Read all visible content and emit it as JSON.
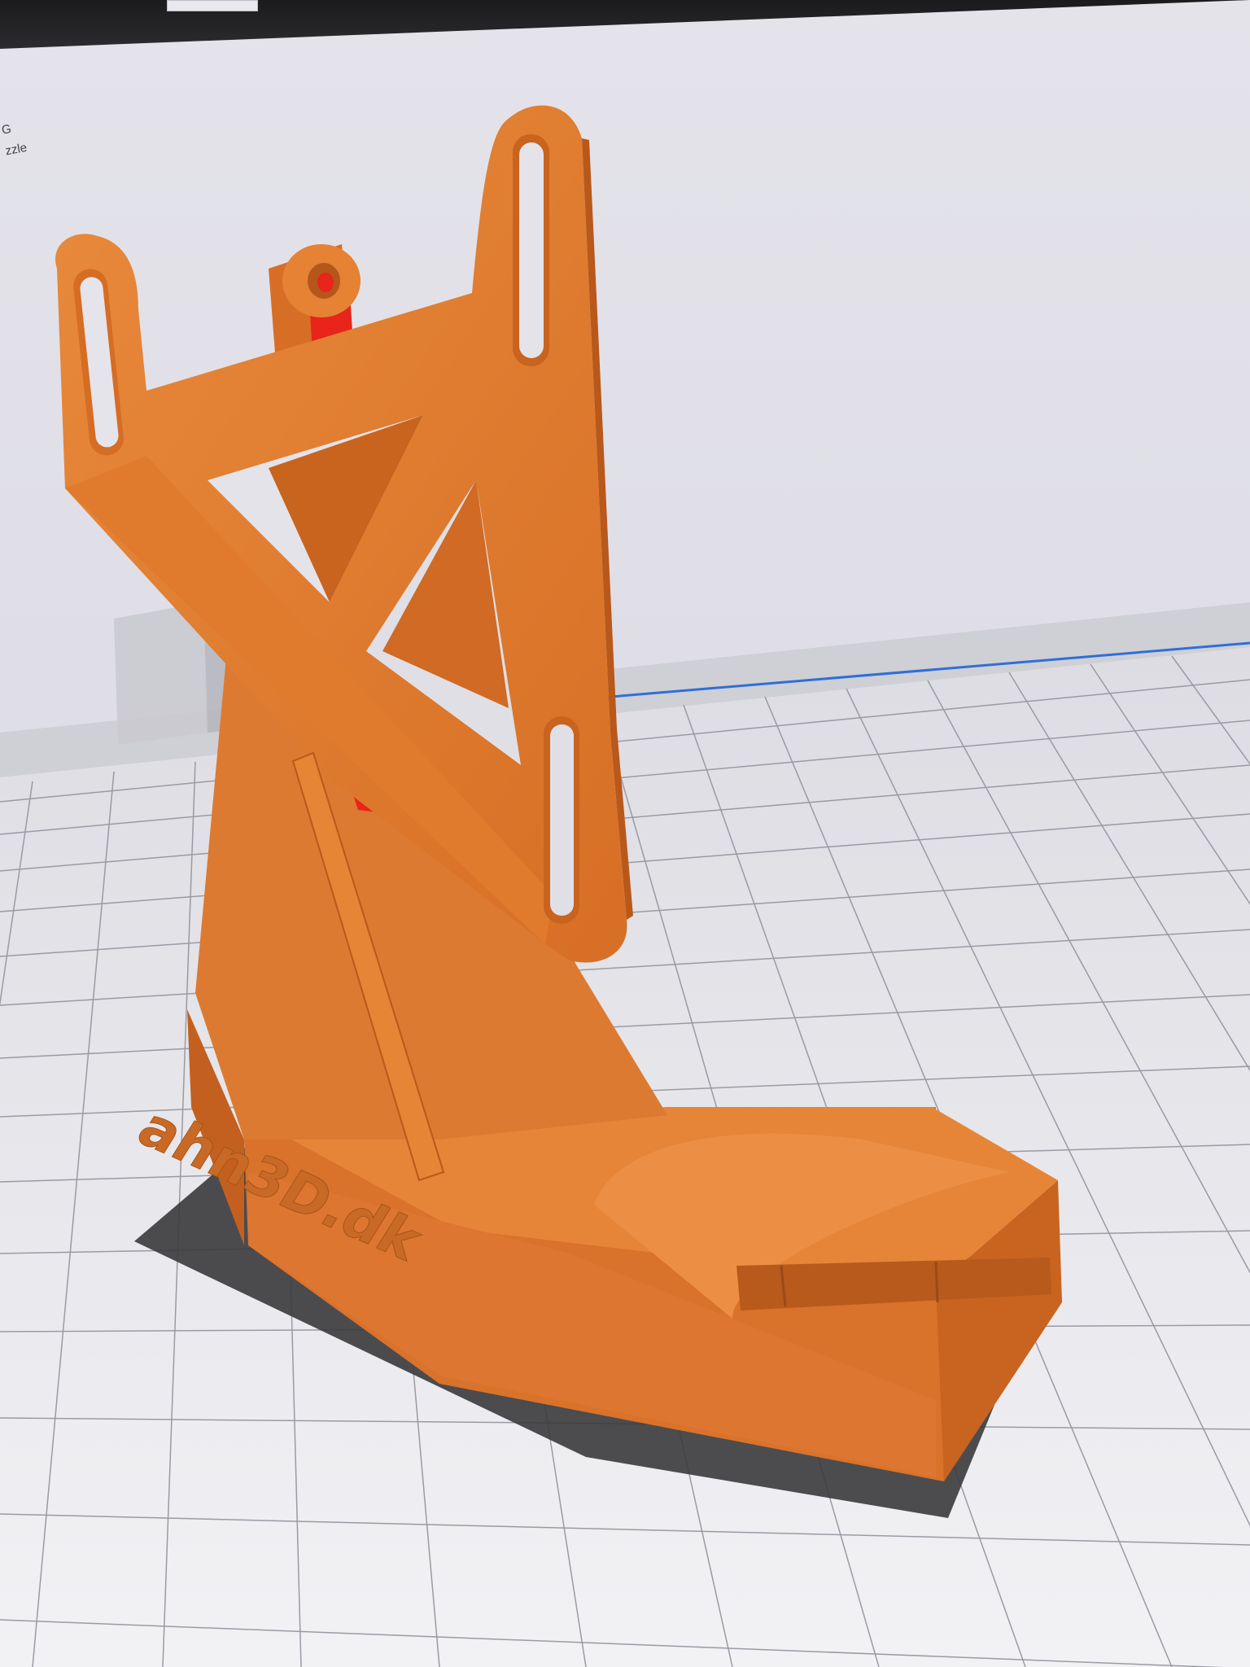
{
  "app": {
    "header_lines": [
      "G",
      "zzle"
    ]
  },
  "viewport": {
    "model_embossed_text": "ahn3D.dk",
    "colors": {
      "model": "#e07b2e",
      "model_shadow": "#b8571a",
      "overhang": "#e8241b",
      "build_plate": "#e9e9ee",
      "grid_line": "#9a9aa4",
      "background": "#e2e1e8",
      "volume_edge": "#2f6fd6"
    }
  }
}
